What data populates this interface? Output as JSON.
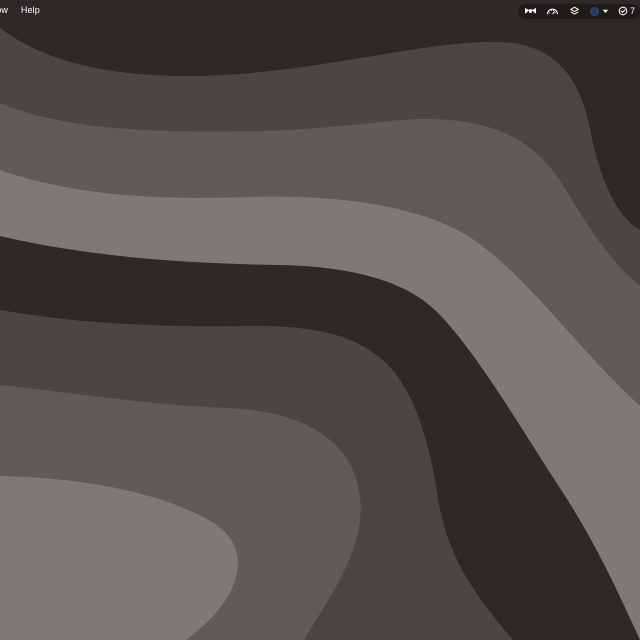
{
  "menubar": {
    "menus": [
      {
        "label": "ndow"
      },
      {
        "label": "Help"
      }
    ]
  },
  "status_items": {
    "bowtie_icon": "bow-tie-icon",
    "gauge_icon": "gauge-icon",
    "layers_icon": "layers-icon",
    "profile_menu_icon": "chevron-down-icon",
    "task_icon": "check-circle-icon",
    "task_count": "7",
    "profile_color": "#243a67"
  },
  "wallpaper": {
    "colors": [
      "#2e2926",
      "#4b4641",
      "#605b56",
      "#7d7974"
    ]
  }
}
